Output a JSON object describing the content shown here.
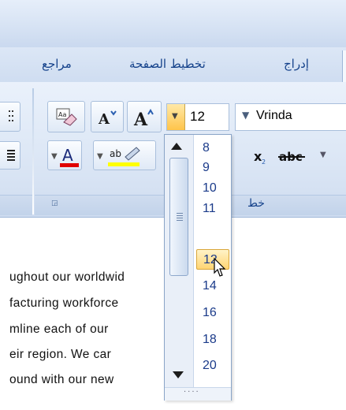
{
  "tabs": [
    {
      "label": "مراجع"
    },
    {
      "label": "تخطيط الصفحة"
    },
    {
      "label": "إدراج"
    }
  ],
  "font": {
    "name": "Vrinda",
    "size": "12"
  },
  "group": {
    "label": "خط"
  },
  "document_lines": [
    "ughout our worldwid",
    "facturing workforce",
    "mline each of our",
    "eir region. We car",
    "ound with our new"
  ],
  "font_size_list": {
    "items": [
      "8",
      "9",
      "10",
      "11",
      "12",
      "14",
      "16",
      "18",
      "20"
    ],
    "selected": "12",
    "footer": "....",
    "highlight_color": "#ffd573"
  },
  "colors": {
    "font_color_bar": "#e00000",
    "highlight_bar": "#ffff00",
    "ribbon_text": "#15428b"
  },
  "icons": {
    "font_color": "A",
    "grow_font": "A",
    "shrink_font": "A",
    "subscript": "x",
    "strikethrough": "abc",
    "highlight": "ab"
  }
}
